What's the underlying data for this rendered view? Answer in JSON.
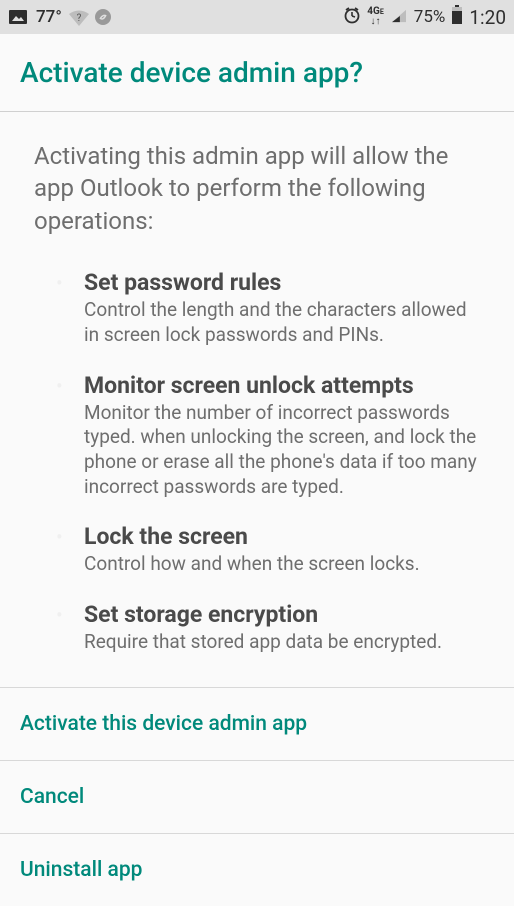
{
  "status_bar": {
    "temperature": "77°",
    "network_type_top": "4G",
    "network_type_sub": "↓↑",
    "battery_percent": "75%",
    "time": "1:20"
  },
  "header": {
    "title": "Activate device admin app?"
  },
  "body": {
    "intro": "Activating this admin app will allow the app Outlook to perform the following operations:",
    "permissions": [
      {
        "title": "Set password rules",
        "description": "Control the length and the characters allowed in screen lock passwords and PINs."
      },
      {
        "title": "Monitor screen unlock attempts",
        "description": "Monitor the number of incorrect passwords typed. when unlocking the screen, and lock the phone or erase all the phone's data if too many incorrect passwords are typed."
      },
      {
        "title": "Lock the screen",
        "description": "Control how and when the screen locks."
      },
      {
        "title": "Set storage encryption",
        "description": "Require that stored app data be encrypted."
      }
    ]
  },
  "actions": {
    "activate": "Activate this device admin app",
    "cancel": "Cancel",
    "uninstall": "Uninstall app"
  }
}
